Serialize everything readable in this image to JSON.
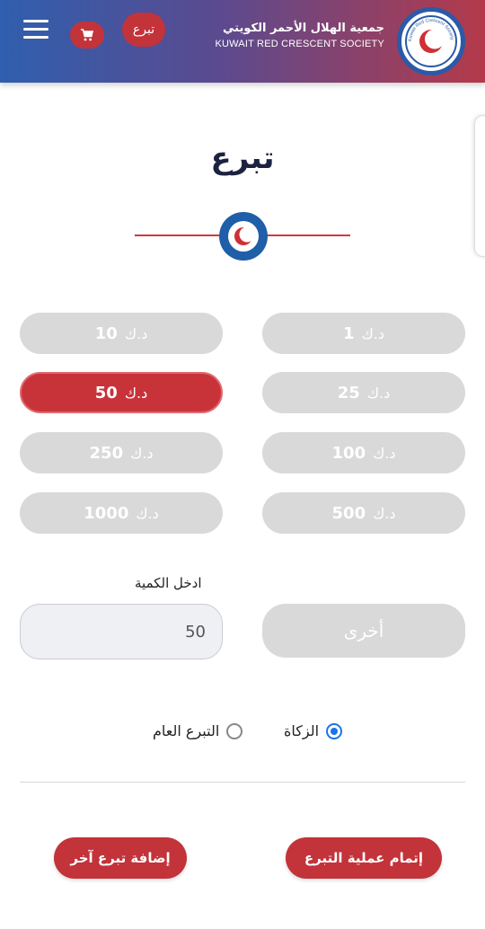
{
  "header": {
    "cart_icon": "cart-icon",
    "donate_label": "تبرع",
    "org_name_ar": "جمعية الهلال الأحمر الكويتي",
    "org_name_en": "KUWAIT RED CRESCENT SOCIETY",
    "logo_text": "Kuwait Red Crescent Society"
  },
  "page": {
    "title": "تبرع"
  },
  "amounts": {
    "currency": "د.ك",
    "items": [
      {
        "value": "1"
      },
      {
        "value": "10"
      },
      {
        "value": "25"
      },
      {
        "value": "50"
      },
      {
        "value": "100"
      },
      {
        "value": "250"
      },
      {
        "value": "500"
      },
      {
        "value": "1000"
      }
    ],
    "selected": "50"
  },
  "quantity": {
    "label": "ادخل الكمية",
    "value": "50",
    "other_label": "أخرى"
  },
  "donation_type": {
    "zakat_label": "الزكاة",
    "general_label": "التبرع العام",
    "selected": "zakat"
  },
  "actions": {
    "complete_label": "إتمام عملية التبرع",
    "add_another_label": "إضافة تبرع آخر"
  },
  "colors": {
    "brand_red": "#c3333a",
    "brand_blue": "#2f5fae",
    "inactive_gray": "#d9d9d9"
  }
}
